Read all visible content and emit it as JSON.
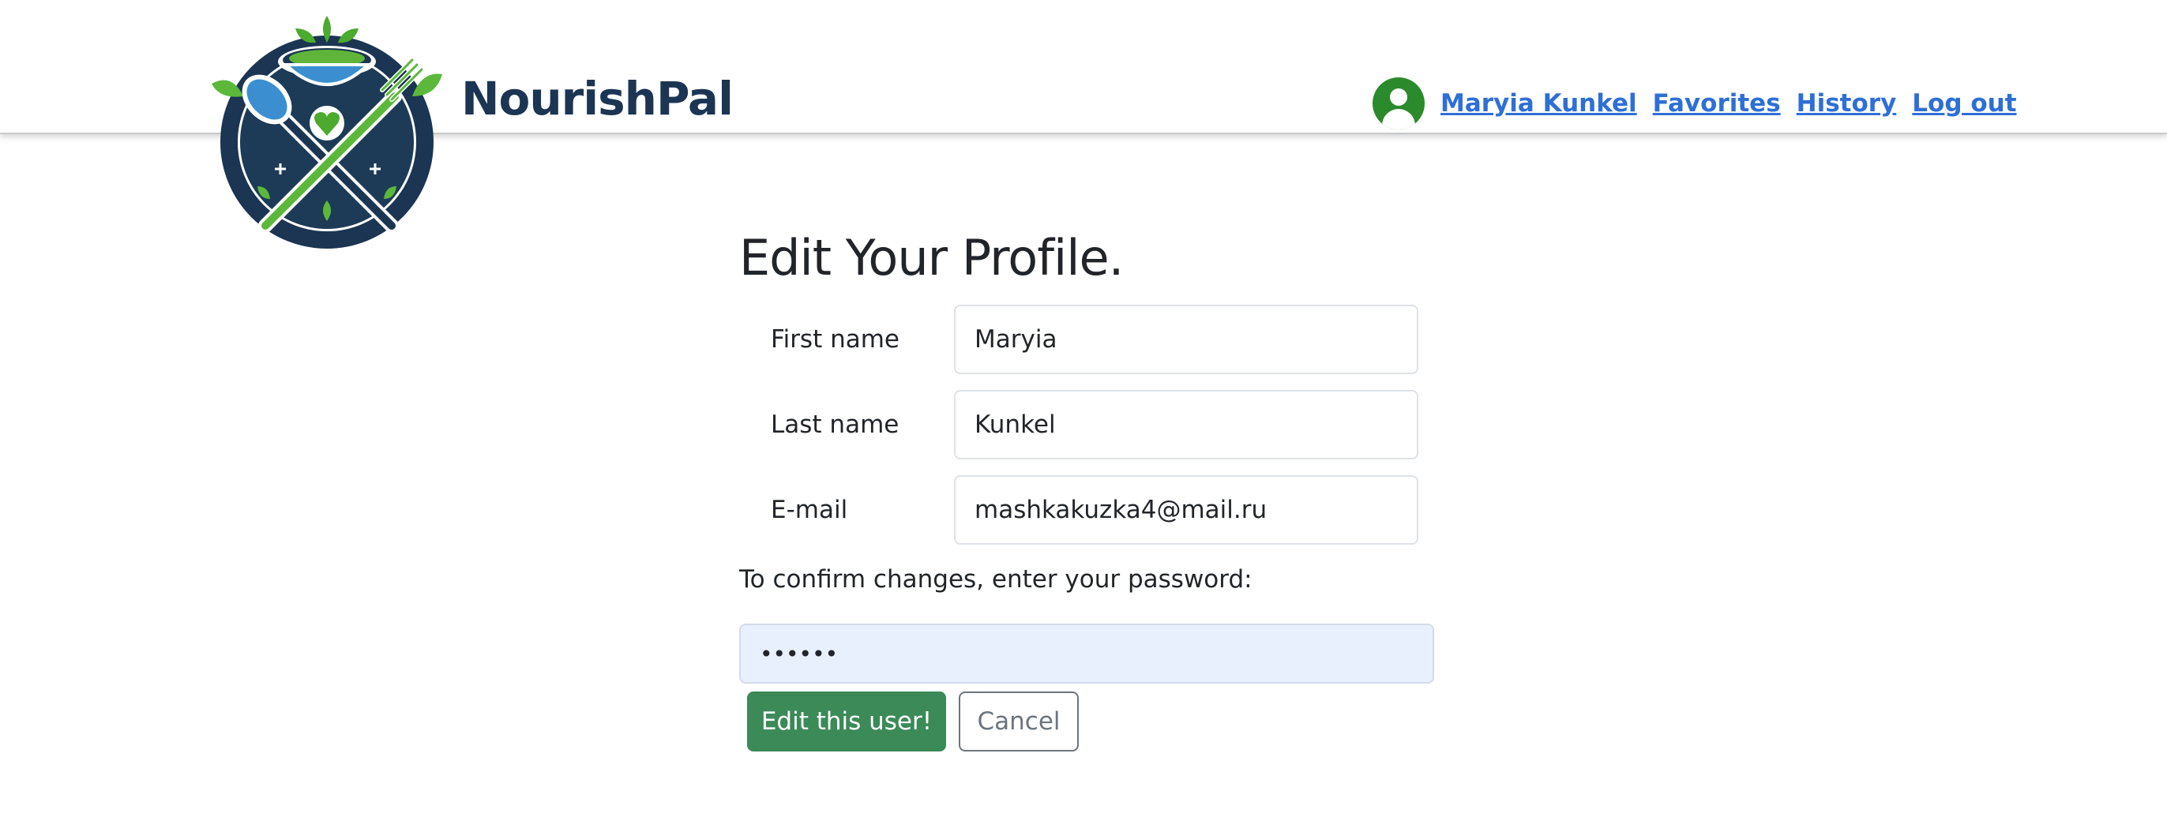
{
  "brand": {
    "name": "NourishPal"
  },
  "nav": {
    "user_name": "Maryia Kunkel",
    "favorites": "Favorites",
    "history": "History",
    "logout": "Log out"
  },
  "form": {
    "title": "Edit Your Profile.",
    "first_name_label": "First name",
    "first_name_value": "Maryia",
    "last_name_label": "Last name",
    "last_name_value": "Kunkel",
    "email_label": "E-mail",
    "email_value": "mashkakuzka4@mail.ru",
    "confirm_text": "To confirm changes, enter your password:",
    "password_value": "••••••",
    "submit_label": "Edit this user!",
    "cancel_label": "Cancel"
  },
  "colors": {
    "brand_navy": "#1b3553",
    "link_blue": "#2e6fd6",
    "avatar_green": "#2b8a2b",
    "submit_green": "#3b8a58",
    "password_bg": "#e8f0fe"
  },
  "icons": {
    "logo": "bowl-spoon-fork-leaves-logo",
    "avatar": "user-avatar-icon"
  }
}
